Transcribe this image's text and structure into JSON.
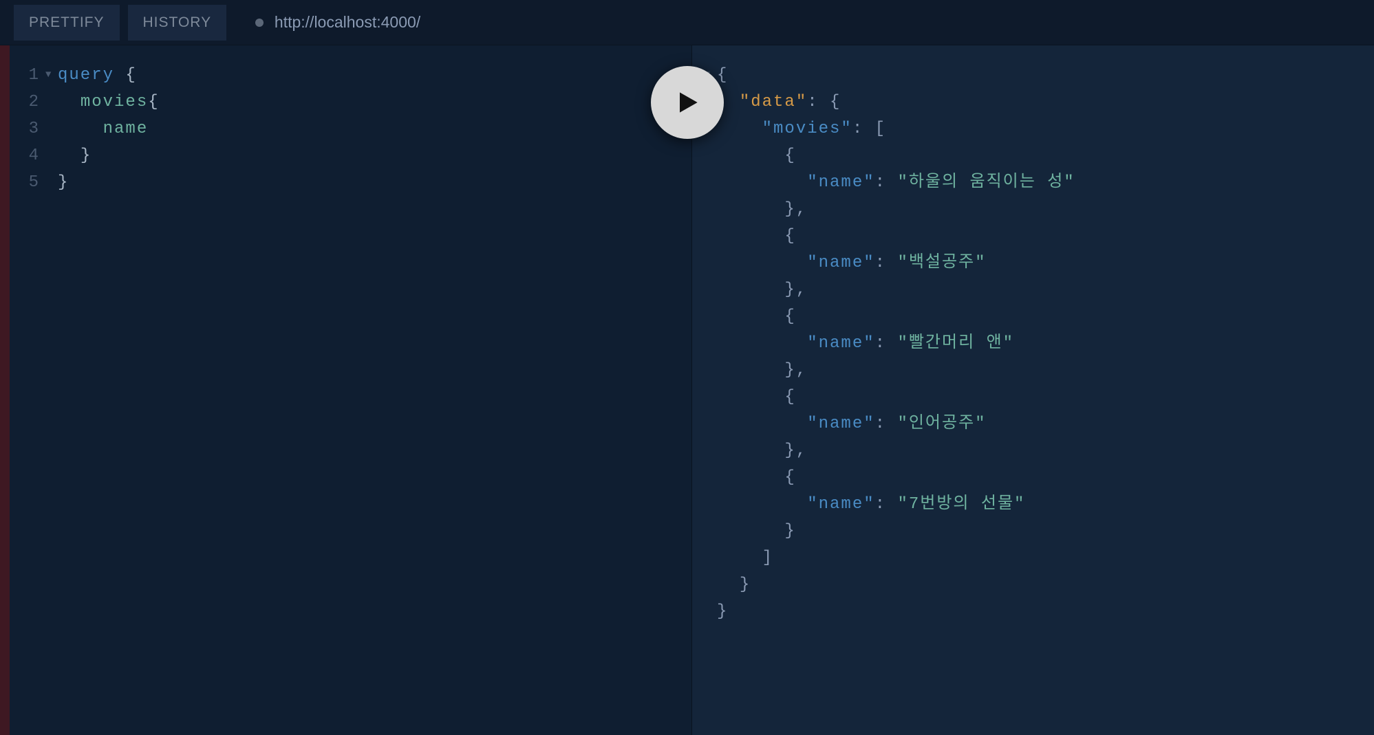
{
  "toolbar": {
    "prettify_label": "PRETTIFY",
    "history_label": "HISTORY",
    "url": "http://localhost:4000/"
  },
  "editor": {
    "line_numbers": [
      "1",
      "2",
      "3",
      "4",
      "5"
    ],
    "fold_markers": [
      "▼",
      "",
      "",
      "",
      ""
    ],
    "tokens": {
      "keyword_query": "query",
      "field_movies": "movies",
      "field_name": "name",
      "brace_open": " {",
      "brace_open2": "{",
      "brace_close": "}"
    }
  },
  "result": {
    "fold_markers": [
      "▼",
      "▼",
      "▼"
    ],
    "key_data": "\"data\"",
    "key_movies": "\"movies\"",
    "key_name": "\"name\"",
    "movies": [
      "\"하울의 움직이는 성\"",
      "\"백설공주\"",
      "\"빨간머리 앤\"",
      "\"인어공주\"",
      "\"7번방의 선물\""
    ]
  }
}
